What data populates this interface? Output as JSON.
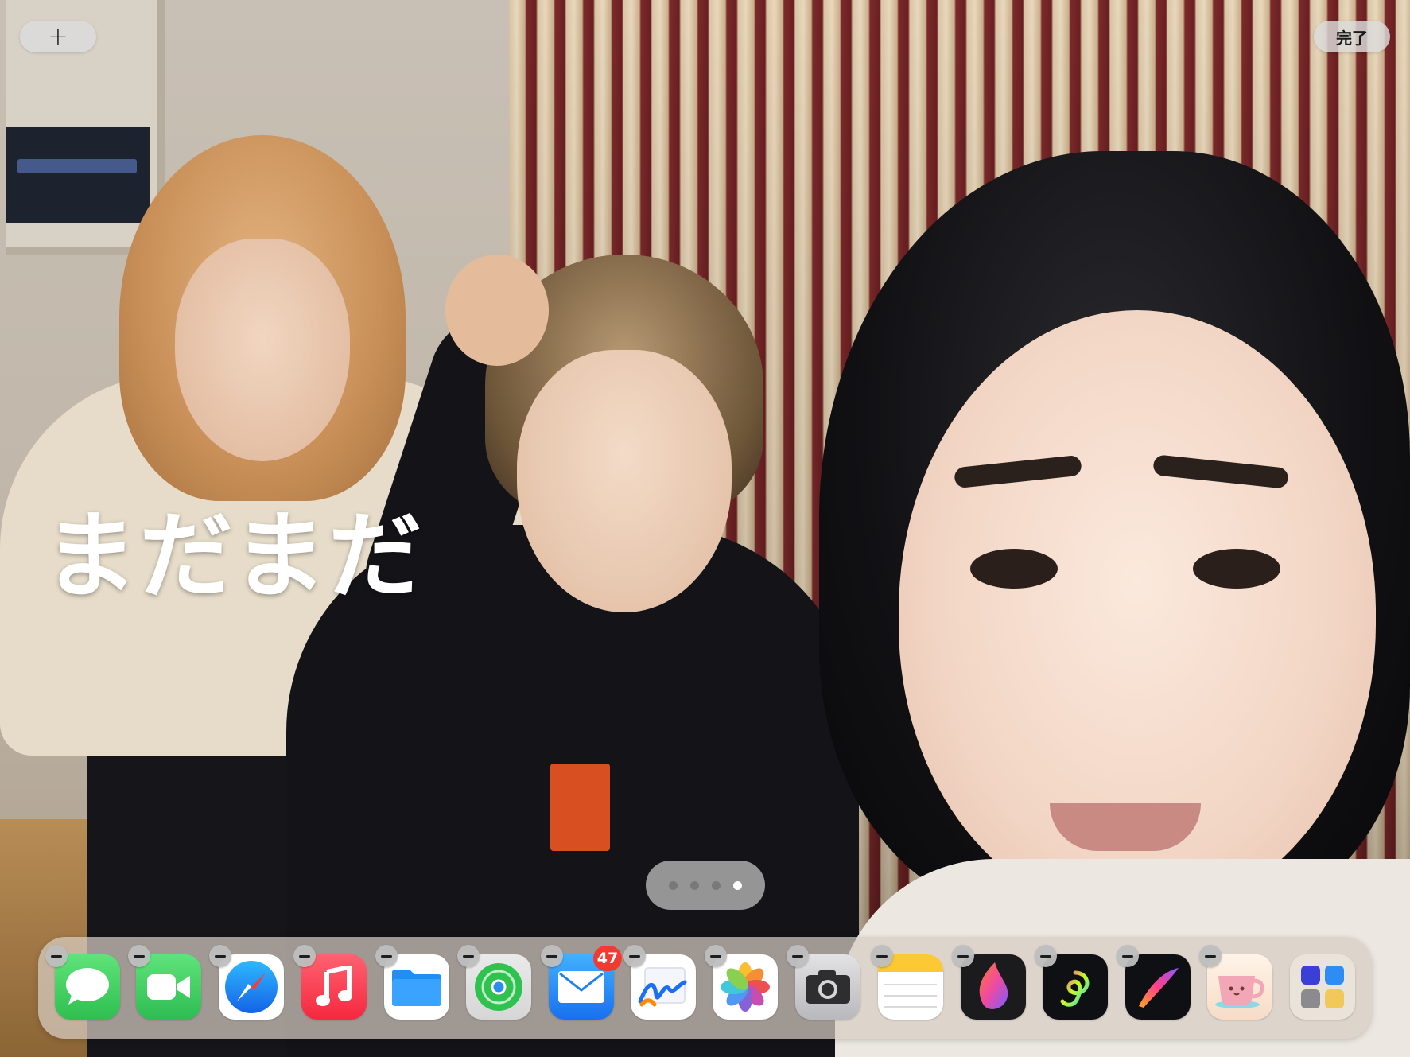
{
  "top_bar": {
    "add_label": "+",
    "done_label": "完了"
  },
  "wallpaper": {
    "caption": "まだまだ"
  },
  "page_indicator": {
    "count": 4,
    "active_index": 3
  },
  "dock": {
    "apps": [
      {
        "name": "messages",
        "color": "#34c759"
      },
      {
        "name": "facetime",
        "color": "#33c85a"
      },
      {
        "name": "safari",
        "color": "#1e88f5"
      },
      {
        "name": "music",
        "color": "#fa3c4d"
      },
      {
        "name": "files",
        "color": "#1a8cf7"
      },
      {
        "name": "find-my",
        "color": "#34c759"
      },
      {
        "name": "mail",
        "color": "#1f8ff5",
        "badge": "47"
      },
      {
        "name": "freeform",
        "color": "#ffffff"
      },
      {
        "name": "photos",
        "color": "#ffffff"
      },
      {
        "name": "camera",
        "color": "#cfcfd2"
      },
      {
        "name": "notes",
        "color": "#fbd04a"
      },
      {
        "name": "procreate-dreams",
        "color": "#1c1c1e"
      },
      {
        "name": "procreate-paint",
        "color": "#101014"
      },
      {
        "name": "procreate",
        "color": "#101014"
      },
      {
        "name": "mug-app",
        "color": "#fbe7d8"
      },
      {
        "name": "app-library",
        "color": "#e9e4de"
      }
    ]
  }
}
